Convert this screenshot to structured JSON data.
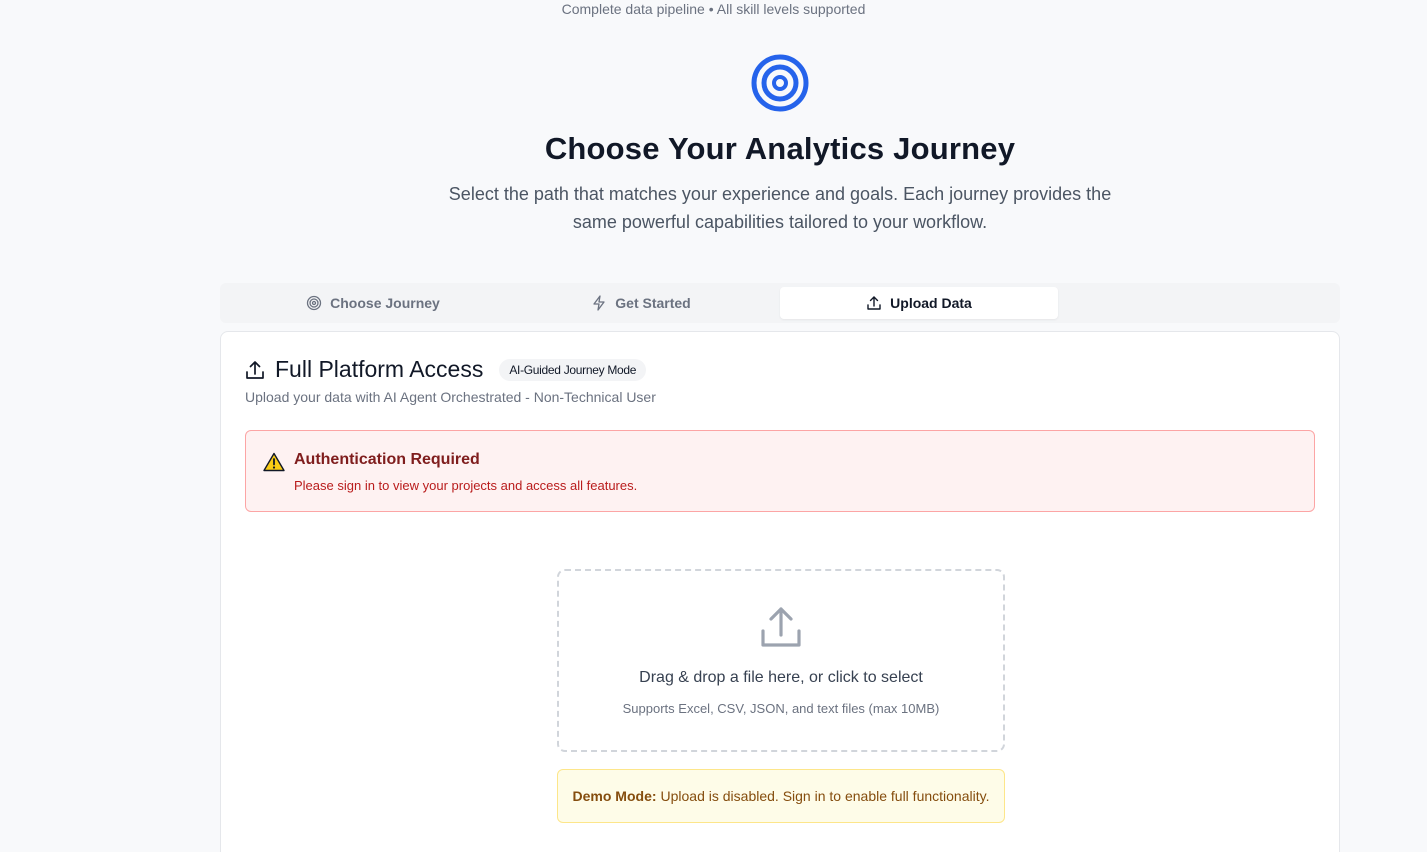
{
  "header": {
    "tagline": "Complete data pipeline • All skill levels supported",
    "title": "Choose Your Analytics Journey",
    "subtitle_line1": "Select the path that matches your experience and goals. Each journey provides the",
    "subtitle_line2": "same powerful capabilities tailored to your workflow."
  },
  "tabs": [
    {
      "label": "Choose Journey",
      "icon": "target-icon",
      "active": false
    },
    {
      "label": "Get Started",
      "icon": "lightning-icon",
      "active": false
    },
    {
      "label": "Upload Data",
      "icon": "upload-icon",
      "active": true
    }
  ],
  "card": {
    "title": "Full Platform Access",
    "badge": "AI-Guided Journey Mode",
    "subtitle": "Upload your data with AI Agent Orchestrated - Non-Technical User"
  },
  "alert": {
    "title": "Authentication Required",
    "text": "Please sign in to view your projects and access all features."
  },
  "dropzone": {
    "main": "Drag & drop a file here, or click to select",
    "sub": "Supports Excel, CSV, JSON, and text files (max 10MB)"
  },
  "demo": {
    "label": "Demo Mode:",
    "text": "Upload is disabled. Sign in to enable full functionality."
  },
  "colors": {
    "accent": "#2563eb",
    "alert_bg": "#fef2f2",
    "alert_title": "#7f1d1d",
    "demo_bg": "#fefce8"
  }
}
